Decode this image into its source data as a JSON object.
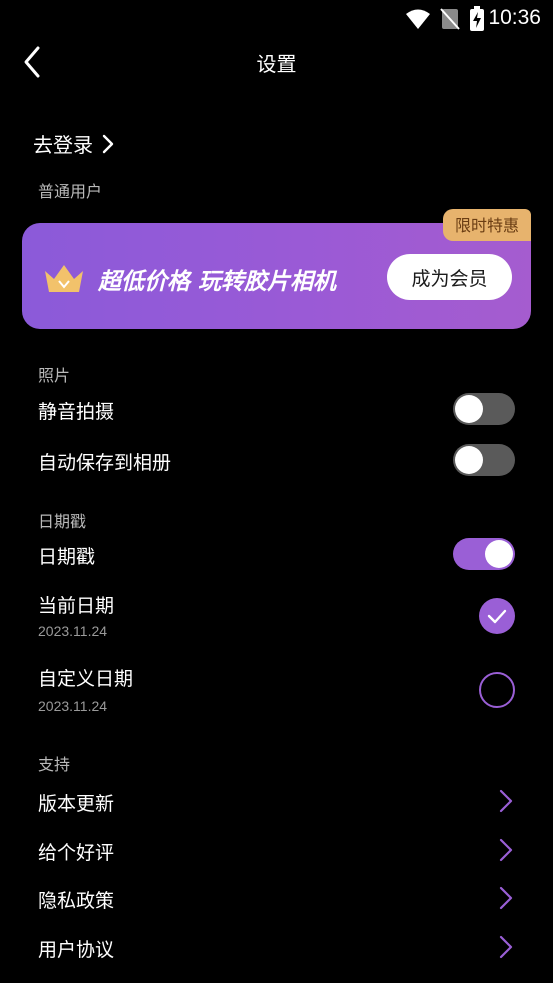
{
  "status": {
    "time": "10:36"
  },
  "header": {
    "title": "设置"
  },
  "account": {
    "login_label": "去登录",
    "user_type": "普通用户"
  },
  "vip": {
    "badge": "限时特惠",
    "slogan": "超低价格 玩转胶片相机",
    "button": "成为会员"
  },
  "photo": {
    "section": "照片",
    "silent_label": "静音拍摄",
    "silent_on": false,
    "autosave_label": "自动保存到相册",
    "autosave_on": false
  },
  "date": {
    "section": "日期戳",
    "stamp_label": "日期戳",
    "stamp_on": true,
    "current_label": "当前日期",
    "current_value": "2023.11.24",
    "current_selected": true,
    "custom_label": "自定义日期",
    "custom_value": "2023.11.24",
    "custom_selected": false
  },
  "support": {
    "section": "支持",
    "items": [
      {
        "label": "版本更新"
      },
      {
        "label": "给个好评"
      },
      {
        "label": "隐私政策"
      },
      {
        "label": "用户协议"
      }
    ]
  },
  "colors": {
    "accent": "#9a5fd6",
    "badge": "#e7b36d",
    "background": "#000000"
  }
}
